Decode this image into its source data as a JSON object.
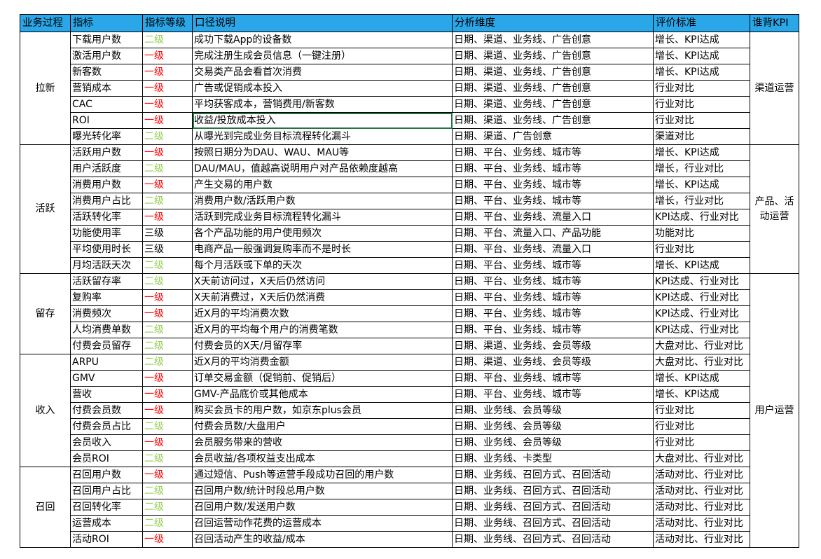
{
  "headers": [
    "业务过程",
    "指标",
    "指标等级",
    "口径说明",
    "分析维度",
    "评价标准",
    "谁背KPI"
  ],
  "level_colors": {
    "一级": "#ff0000",
    "二级": "#92d050",
    "三级": "#000000"
  },
  "header_bg": "#2aa7e8",
  "groups": [
    {
      "name": "拉新",
      "kpi": "渠道运营",
      "rows": [
        {
          "metric": "下载用户数",
          "level": "二级",
          "desc": "成功下载App的设备数",
          "dims": "日期、渠道、业务线、广告创意",
          "std": "增长、KPI达成"
        },
        {
          "metric": "激活用户数",
          "level": "一级",
          "desc": "完成注册生成会员信息（一键注册）",
          "dims": "日期、渠道、业务线、广告创意",
          "std": "增长、KPI达成"
        },
        {
          "metric": "新客数",
          "level": "一级",
          "desc": "交易类产品会看首次消费",
          "dims": "日期、渠道、业务线、广告创意",
          "std": "增长、KPI达成"
        },
        {
          "metric": "营销成本",
          "level": "一级",
          "desc": "广告或促销成本投入",
          "dims": "日期、渠道、业务线、广告创意",
          "std": "行业对比"
        },
        {
          "metric": "CAC",
          "level": "一级",
          "desc": "平均获客成本，营销费用/新客数",
          "dims": "日期、渠道、业务线、广告创意",
          "std": "行业对比"
        },
        {
          "metric": "ROI",
          "level": "一级",
          "desc": "收益/投放成本投入",
          "dims": "日期、渠道、业务线、广告创意",
          "std": "行业对比"
        },
        {
          "metric": "曝光转化率",
          "level": "二级",
          "desc": "从曝光到完成业务目标流程转化漏斗",
          "dims": "日期、渠道、广告创意",
          "std": "渠道对比"
        }
      ]
    },
    {
      "name": "活跃",
      "kpi": "产品、活动运营",
      "rows": [
        {
          "metric": "活跃用户数",
          "level": "一级",
          "desc": "按照日期分为DAU、WAU、MAU等",
          "dims": "日期、平台、业务线、城市等",
          "std": "增长、KPI达成"
        },
        {
          "metric": "用户活跃度",
          "level": "二级",
          "desc": "DAU/MAU，值越高说明用户对产品依赖度越高",
          "dims": "日期、平台、业务线、城市等",
          "std": "增长，行业对比"
        },
        {
          "metric": "消费用户数",
          "level": "一级",
          "desc": "产生交易的用户数",
          "dims": "日期、平台、业务线、城市等",
          "std": "增长、KPI达成"
        },
        {
          "metric": "消费用户占比",
          "level": "二级",
          "desc": "消费用户数/活跃用户数",
          "dims": "日期、平台、业务线、城市等",
          "std": "增长，行业对比"
        },
        {
          "metric": "活跃转化率",
          "level": "一级",
          "desc": "活跃到完成业务目标流程转化漏斗",
          "dims": "日期、平台、业务线、流量入口",
          "std": "KPI达成、行业对比"
        },
        {
          "metric": "功能使用率",
          "level": "三级",
          "desc": "各个产品功能的用户使用频次",
          "dims": "日期、平台、流量入口、产品功能",
          "std": "功能对比"
        },
        {
          "metric": "平均使用时长",
          "level": "三级",
          "desc": "电商产品一般强调复购率而不是时长",
          "dims": "日期、平台、业务线、流量入口",
          "std": "行业对比"
        },
        {
          "metric": "月均活跃天次",
          "level": "二级",
          "desc": "每个月活跃或下单的天次",
          "dims": "日期、平台、业务线、城市等",
          "std": "增长、KPI达成"
        }
      ]
    },
    {
      "name": "留存",
      "kpi": "",
      "rows": [
        {
          "metric": "活跃留存率",
          "level": "二级",
          "desc": "X天前访问过，X天后仍然访问",
          "dims": "日期、平台、业务线、城市等",
          "std": "KPI达成、行业对比"
        },
        {
          "metric": "复购率",
          "level": "一级",
          "desc": "X天前消费过，X天后仍然消费",
          "dims": "日期、平台、业务线、城市等",
          "std": "KPI达成、行业对比"
        },
        {
          "metric": "消费频次",
          "level": "一级",
          "desc": "近X月的平均消费次数",
          "dims": "日期、平台、业务线、城市等",
          "std": "KPI达成、行业对比"
        },
        {
          "metric": "人均消费单数",
          "level": "二级",
          "desc": "近X月的平均每个用户的消费笔数",
          "dims": "日期、平台、业务线、城市等",
          "std": "KPI达成、行业对比"
        },
        {
          "metric": "付费会员留存",
          "level": "二级",
          "desc": "付费会员的X天/月留存率",
          "dims": "日期、渠道、业务线、会员等级",
          "std": "大盘对比、行业对比"
        }
      ]
    },
    {
      "name": "收入",
      "kpi": "用户运营",
      "rows": [
        {
          "metric": "ARPU",
          "level": "二级",
          "desc": "近X月的平均消费金额",
          "dims": "日期、渠道、业务线、会员等级",
          "std": "大盘对比、行业对比"
        },
        {
          "metric": "GMV",
          "level": "一级",
          "desc": "订单交易金额（促销前、促销后）",
          "dims": "日期、平台、业务线、城市等",
          "std": "增长、KPI达成"
        },
        {
          "metric": "营收",
          "level": "一级",
          "desc": "GMV-产品底价或其他成本",
          "dims": "日期、平台、业务线、城市等",
          "std": "增长、KPI达成"
        },
        {
          "metric": "付费会员数",
          "level": "一级",
          "desc": "购买会员卡的用户数，如京东plus会员",
          "dims": "日期、业务线、会员等级",
          "std": "行业对比"
        },
        {
          "metric": "付费会员占比",
          "level": "二级",
          "desc": "付费会员数/大盘用户",
          "dims": "日期、业务线、会员等级",
          "std": "行业对比"
        },
        {
          "metric": "会员收入",
          "level": "一级",
          "desc": "会员服务带来的营收",
          "dims": "日期、业务线、会员等级",
          "std": "行业对比"
        },
        {
          "metric": "会员ROI",
          "level": "二级",
          "desc": "会员收益/各项权益支出成本",
          "dims": "日期、业务线、卡类型",
          "std": "大盘对比、行业对比"
        }
      ]
    },
    {
      "name": "召回",
      "kpi": "",
      "rows": [
        {
          "metric": "召回用户数",
          "level": "一级",
          "desc": "通过短信、Push等运营手段成功召回的用户数",
          "dims": "日期、业务线、召回方式、召回活动",
          "std": "活动对比、行业对比"
        },
        {
          "metric": "召回用户占比",
          "level": "二级",
          "desc": "召回用户数/统计时段总用户数",
          "dims": "日期、业务线、召回方式、召回活动",
          "std": "活动对比、行业对比"
        },
        {
          "metric": "召回转化率",
          "level": "二级",
          "desc": "召回用户数/发送用户数",
          "dims": "日期、业务线、召回方式、召回活动",
          "std": "活动对比、行业对比"
        },
        {
          "metric": "运营成本",
          "level": "二级",
          "desc": "召回运营动作花费的运营成本",
          "dims": "日期、业务线、召回方式、召回活动",
          "std": "活动对比、行业对比"
        },
        {
          "metric": "活动ROI",
          "level": "一级",
          "desc": "召回活动产生的收益/成本",
          "dims": "日期、业务线、召回方式、召回活动",
          "std": "活动对比、行业对比"
        }
      ]
    }
  ]
}
